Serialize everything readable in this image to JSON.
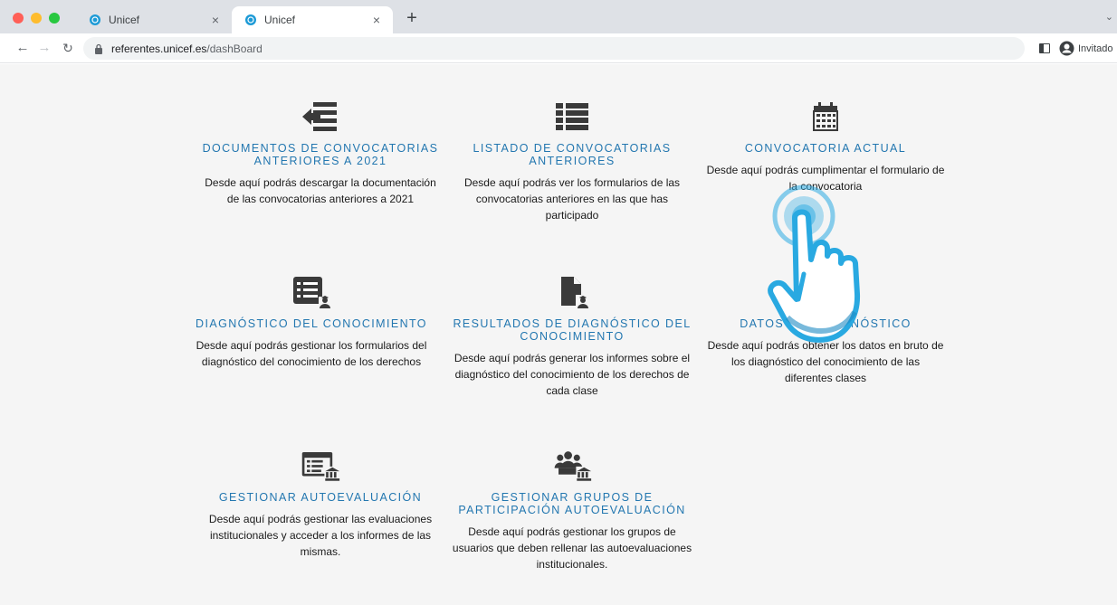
{
  "browser": {
    "tabs": [
      {
        "title": "Unicef",
        "active": false
      },
      {
        "title": "Unicef",
        "active": true
      }
    ],
    "url_host": "referentes.unicef.es",
    "url_path": "/dashBoard",
    "profile_label": "Invitado"
  },
  "colors": {
    "title_blue": "#2377b0",
    "icon_dark": "#3a3a3a",
    "hand_blue": "#29a9e1",
    "page_bg": "#f5f5f5"
  },
  "cards": [
    {
      "icon": "file-import-icon",
      "title_lines": [
        "DOCUMENTOS DE CONVOCATORIAS",
        "ANTERIORES A 2021"
      ],
      "desc_lines": [
        "Desde aquí podrás descargar la documentación",
        "de las convocatorias anteriores a 2021"
      ]
    },
    {
      "icon": "list-icon",
      "title_lines": [
        "LISTADO DE CONVOCATORIAS",
        "ANTERIORES"
      ],
      "desc_lines": [
        "Desde aquí podrás ver los formularios de las",
        "convocatorias anteriores en las que has",
        "participado"
      ]
    },
    {
      "icon": "calendar-icon",
      "title_lines": [
        "CONVOCATORIA ACTUAL"
      ],
      "desc_lines": [
        "Desde aquí podrás cumplimentar el formulario de",
        "la convocatoria"
      ]
    },
    {
      "icon": "list-user-icon",
      "title_lines": [
        "DIAGNÓSTICO DEL CONOCIMIENTO"
      ],
      "desc_lines": [
        "Desde aquí podrás gestionar los formularios del",
        "diagnóstico del conocimiento de los derechos"
      ]
    },
    {
      "icon": "file-user-icon",
      "title_lines": [
        "RESULTADOS DE DIAGNÓSTICO DEL",
        "CONOCIMIENTO"
      ],
      "desc_lines": [
        "Desde aquí podrás generar los informes sobre el",
        "diagnóstico del conocimiento de los derechos de",
        "cada clase"
      ]
    },
    {
      "icon": "table-user-icon",
      "title_lines": [
        "DATOS DEL DIAGNÓSTICO"
      ],
      "desc_lines": [
        "Desde aquí podrás obtener los datos en bruto de",
        "los diagnóstico del conocimiento de las",
        "diferentes clases"
      ]
    },
    {
      "icon": "form-institution-icon",
      "title_lines": [
        "GESTIONAR AUTOEVALUACIÓN"
      ],
      "desc_lines": [
        "Desde aquí podrás gestionar las evaluaciones",
        "institucionales y acceder a los informes de las",
        "mismas."
      ]
    },
    {
      "icon": "group-institution-icon",
      "title_lines": [
        "GESTIONAR GRUPOS DE",
        "PARTICIPACIÓN AUTOEVALUACIÓN"
      ],
      "desc_lines": [
        "Desde aquí podrás gestionar los grupos de",
        "usuarios que deben rellenar las autoevaluaciones",
        "institucionales."
      ]
    }
  ]
}
